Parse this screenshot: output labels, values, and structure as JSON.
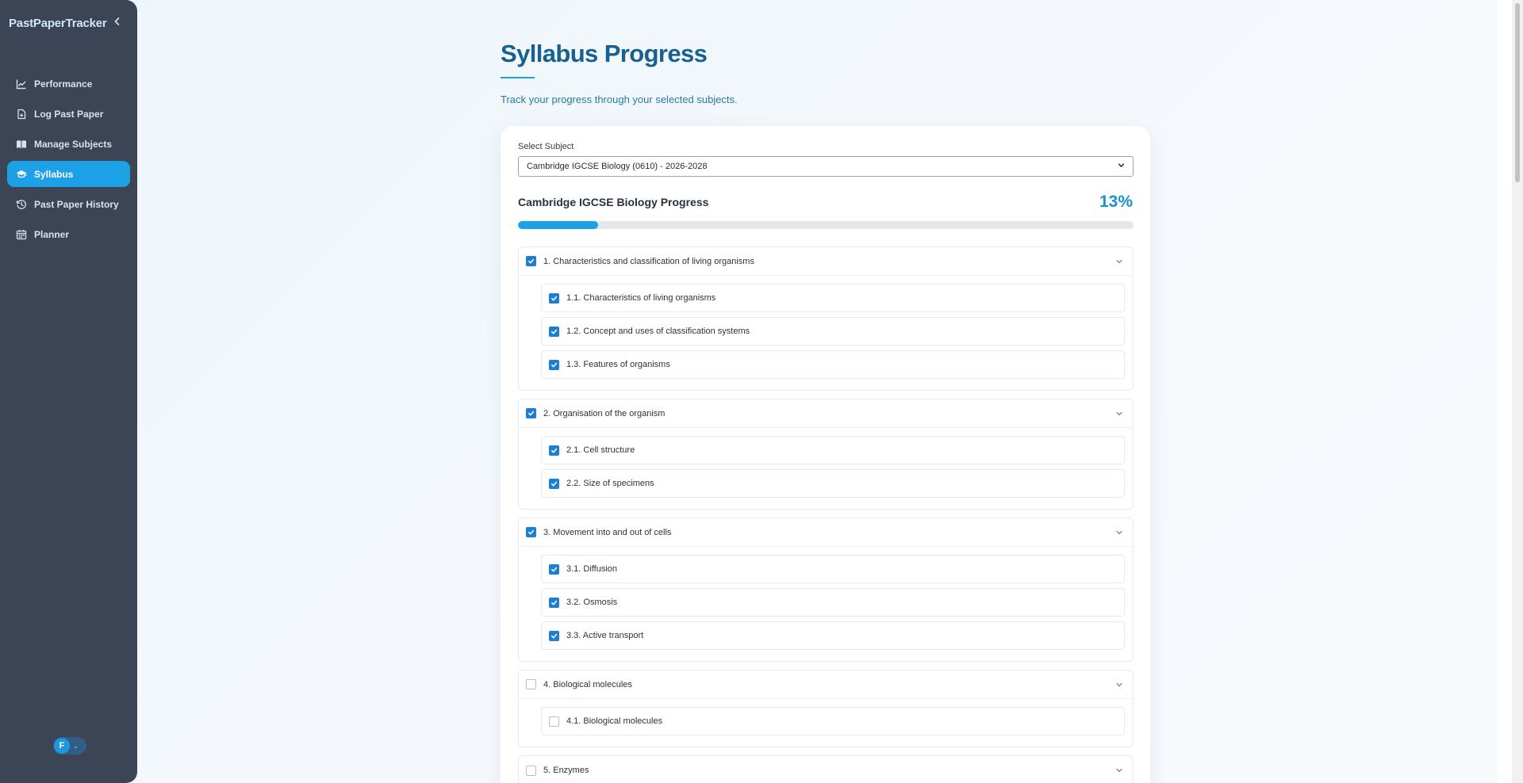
{
  "app": {
    "name": "PastPaperTracker",
    "collapse_icon": "chevron-left-icon"
  },
  "sidebar": {
    "items": [
      {
        "label": "Performance",
        "icon": "chart-line-icon",
        "active": false
      },
      {
        "label": "Log Past Paper",
        "icon": "file-plus-icon",
        "active": false
      },
      {
        "label": "Manage Subjects",
        "icon": "book-open-icon",
        "active": false
      },
      {
        "label": "Syllabus",
        "icon": "graduation-cap-icon",
        "active": true
      },
      {
        "label": "Past Paper History",
        "icon": "history-icon",
        "active": false
      },
      {
        "label": "Planner",
        "icon": "calendar-icon",
        "active": false
      }
    ],
    "user": {
      "initial": "F"
    }
  },
  "main": {
    "title": "Syllabus Progress",
    "subtitle": "Track your progress through your selected subjects.",
    "select_label": "Select Subject",
    "selected_subject": "Cambridge IGCSE Biology (0610) - 2026-2028",
    "progress_title": "Cambridge IGCSE Biology Progress",
    "progress_text": "13%",
    "progress_value": 0.13,
    "colors": {
      "accent": "#1da1e6",
      "title": "#17608f",
      "sidebar": "#3b4556",
      "checkbox": "#1c7fd1"
    }
  },
  "sections": [
    {
      "title": "1. Characteristics and classification of living organisms",
      "checked": true,
      "items": [
        {
          "label": "1.1. Characteristics of living organisms",
          "checked": true
        },
        {
          "label": "1.2. Concept and uses of classification systems",
          "checked": true
        },
        {
          "label": "1.3. Features of organisms",
          "checked": true
        }
      ]
    },
    {
      "title": "2. Organisation of the organism",
      "checked": true,
      "items": [
        {
          "label": "2.1. Cell structure",
          "checked": true
        },
        {
          "label": "2.2. Size of specimens",
          "checked": true
        }
      ]
    },
    {
      "title": "3. Movement into and out of cells",
      "checked": true,
      "items": [
        {
          "label": "3.1. Diffusion",
          "checked": true
        },
        {
          "label": "3.2. Osmosis",
          "checked": true
        },
        {
          "label": "3.3. Active transport",
          "checked": true
        }
      ]
    },
    {
      "title": "4. Biological molecules",
      "checked": false,
      "items": [
        {
          "label": "4.1. Biological molecules",
          "checked": false
        }
      ]
    },
    {
      "title": "5. Enzymes",
      "checked": false,
      "items": []
    }
  ]
}
